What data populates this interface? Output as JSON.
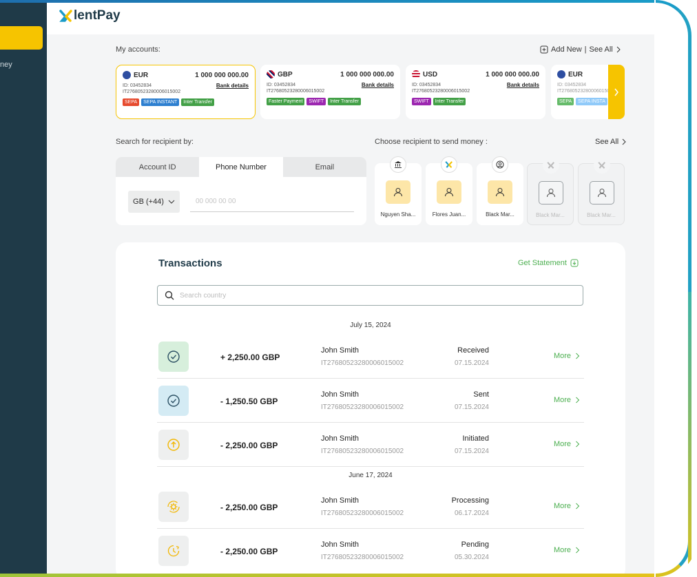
{
  "brand": {
    "name": "lentPay",
    "accent": "#f6c400",
    "dark": "#1f3a48",
    "green": "#4caf50"
  },
  "sidebar": {
    "partial_label": "ney"
  },
  "accounts": {
    "label": "My accounts:",
    "add_new": "Add New",
    "see_all": "See All",
    "items": [
      {
        "currency": "EUR",
        "balance": "1 000 000 000.00",
        "id": "ID: 03452834",
        "iban": "IT27680523280006015002",
        "bank_details": "Bank details",
        "tags": [
          "SEPA",
          "SEPA INSTANT",
          "Inter Transfer"
        ],
        "selected": true,
        "flag_icon": "eu-flag-icon"
      },
      {
        "currency": "GBP",
        "balance": "1 000 000 000.00",
        "id": "ID: 03452834",
        "iban": "IT27680523280006015002",
        "bank_details": "Bank details",
        "tags": [
          "Faster Payment",
          "SWIFT",
          "Inter Transfer"
        ],
        "flag_icon": "uk-flag-icon"
      },
      {
        "currency": "USD",
        "balance": "1 000 000 000.00",
        "id": "ID: 03452834",
        "iban": "IT27680523280006015002",
        "bank_details": "Bank details",
        "tags": [
          "SWIFT",
          "Inter Transfer"
        ],
        "flag_icon": "us-flag-icon"
      },
      {
        "currency": "EUR",
        "balance": "",
        "id": "ID: 03452834",
        "iban": "IT27680523280006015002",
        "bank_details": "",
        "tags": [
          "SEPA",
          "SEPA INSTA"
        ],
        "flag_icon": "eu-flag-icon"
      }
    ]
  },
  "search": {
    "label": "Search for recipient by:",
    "tabs": [
      "Account ID",
      "Phone Number",
      "Email"
    ],
    "active_tab": "Phone Number",
    "country_code": "GB (+44)",
    "phone_placeholder": "00 000 00 00"
  },
  "recipients": {
    "label": "Choose recipient to  send money :",
    "see_all": "See All",
    "items": [
      {
        "name": "Nguyen Sha...",
        "badge_icon": "bank-icon",
        "dim": false
      },
      {
        "name": "Flores Juan...",
        "badge_icon": "xlentpay-logo-icon",
        "dim": false
      },
      {
        "name": "Black Mar...",
        "badge_icon": "user-circle-icon",
        "dim": false
      },
      {
        "name": "Black Mar...",
        "badge_icon": "xlentpay-logo-icon",
        "dim": true
      },
      {
        "name": "Black Mar...",
        "badge_icon": "xlentpay-logo-icon",
        "dim": true
      }
    ]
  },
  "transactions": {
    "title": "Transactions",
    "get_statement": "Get Statement",
    "search_placeholder": "Search country",
    "groups": [
      {
        "date": "July 15, 2024",
        "rows": [
          {
            "amount": "+ 2,250.00 GBP",
            "name": "John Smith",
            "iban": "IT27680523280006015002",
            "status": "Received",
            "date": "07.15.2024",
            "icon": "check-circle-icon",
            "tint": "#d7efdc",
            "color": "#2f7a3d"
          },
          {
            "amount": "- 1,250.50 GBP",
            "name": "John Smith",
            "iban": "IT27680523280006015002",
            "status": "Sent",
            "date": "07.15.2024",
            "icon": "check-circle-icon",
            "tint": "#d4ebf4",
            "color": "#2b4f63"
          },
          {
            "amount": "- 2,250.00 GBP",
            "name": "John Smith",
            "iban": "IT27680523280006015002",
            "status": "Initiated",
            "date": "07.15.2024",
            "icon": "arrow-up-circle-icon",
            "tint": "#eeefef",
            "color": "#f2b600"
          }
        ]
      },
      {
        "date": "June 17, 2024",
        "rows": [
          {
            "amount": "- 2,250.00 GBP",
            "name": "John Smith",
            "iban": "IT27680523280006015002",
            "status": "Processing",
            "date": "06.17.2024",
            "icon": "gear-sync-icon",
            "tint": "#eeefef",
            "color": "#f2b600"
          },
          {
            "amount": "- 2,250.00 GBP",
            "name": "John Smith",
            "iban": "IT27680523280006015002",
            "status": "Pending",
            "date": "05.30.2024",
            "icon": "clock-icon",
            "tint": "#eeefef",
            "color": "#f2b600"
          }
        ]
      }
    ],
    "more_label": "More"
  }
}
